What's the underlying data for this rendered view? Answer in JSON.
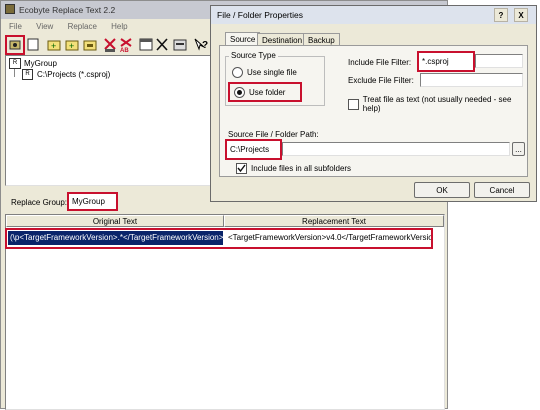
{
  "app": {
    "title": "Ecobyte Replace Text 2.2",
    "menu": [
      "File",
      "View",
      "Replace",
      "Help"
    ],
    "tree": {
      "group": "MyGroup",
      "child": "C:\\Projects (*.csproj)"
    },
    "replace_group_label": "Replace Group:",
    "replace_group_value": "MyGroup",
    "table": {
      "headers": [
        "Original Text",
        "Replacement Text"
      ],
      "row": {
        "original": "(\\p<TargetFrameworkVersion>.*</TargetFrameworkVersion>",
        "replacement": "<TargetFrameworkVersion>v4.0</TargetFrameworkVersion>"
      }
    },
    "toolbar_icons": [
      "properties-icon",
      "new-icon",
      "add-icon",
      "folder-icon",
      "folder2-icon",
      "replace-icon",
      "replace-ab-icon",
      "window-icon",
      "delete-icon",
      "props2-icon",
      "help-icon"
    ]
  },
  "dialog": {
    "title": "File / Folder Properties",
    "tabs": [
      "Source",
      "Destination",
      "Backup"
    ],
    "source_type_label": "Source Type",
    "use_single_file": "Use single file",
    "use_folder": "Use folder",
    "include_filter_label": "Include File Filter:",
    "include_filter_value": "*.csproj",
    "exclude_filter_label": "Exclude File Filter:",
    "exclude_filter_value": "",
    "treat_text_label": "Treat file as text (not usually needed - see help)",
    "path_label": "Source File / Folder Path:",
    "path_value": "C:\\Projects",
    "browse_label": "...",
    "include_subfolders_label": "Include files in all subfolders",
    "ok_label": "OK",
    "cancel_label": "Cancel",
    "help_btn": "?",
    "close_btn": "X"
  },
  "colors": {
    "highlight": "#c8102e",
    "selection": "#0a246a"
  }
}
